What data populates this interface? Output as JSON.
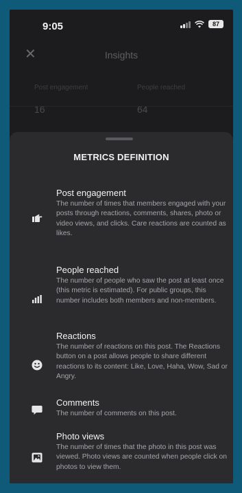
{
  "status_bar": {
    "time": "9:05",
    "battery": "87"
  },
  "app": {
    "title": "Insights",
    "stats": [
      {
        "label": "Post engagement",
        "value": "16"
      },
      {
        "label": "People reached",
        "value": "64"
      }
    ]
  },
  "sheet": {
    "title": "METRICS DEFINITION",
    "metrics": [
      {
        "icon": "pointing-hand-icon",
        "name": "Post engagement",
        "description": "The number of times that members engaged with your posts through reactions, comments, shares, photo or video views, and clicks. Care reactions are counted as likes."
      },
      {
        "icon": "bar-chart-icon",
        "name": "People reached",
        "description": "The number of people who saw the post at least once (this metric is estimated). For public groups, this number includes both members and non-members."
      },
      {
        "icon": "smiley-icon",
        "name": "Reactions",
        "description": "The number of reactions on this post. The Reactions button on a post allows people to share different reactions to its content: Like, Love, Haha, Wow, Sad or Angry."
      },
      {
        "icon": "comment-bubble-icon",
        "name": "Comments",
        "description": "The number of comments on this post."
      },
      {
        "icon": "photo-icon",
        "name": "Photo views",
        "description": "The number of times that the photo in this post was viewed. Photo views are counted when people click on photos to view them."
      }
    ]
  },
  "colors": {
    "frame": "#0e5a78",
    "screen": "#1c1c1e",
    "sheet": "#2b2b2e",
    "text": "#f2f2f2",
    "muted": "#a6a6aa"
  }
}
